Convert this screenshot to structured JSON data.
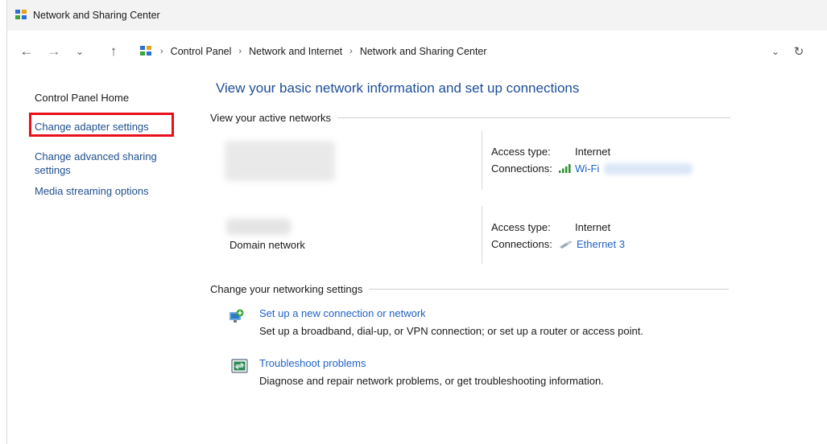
{
  "window": {
    "title": "Network and Sharing Center"
  },
  "nav": {
    "back_icon": "back-arrow-icon",
    "forward_icon": "forward-arrow-icon",
    "recent_icon": "chevron-down-icon",
    "up_icon": "up-arrow-icon",
    "breadcrumb": [
      "Control Panel",
      "Network and Internet",
      "Network and Sharing Center"
    ],
    "dropdown_icon": "chevron-down-icon",
    "refresh_icon": "refresh-icon"
  },
  "left_pane": {
    "home": "Control Panel Home",
    "links": [
      "Change adapter settings",
      "Change advanced sharing settings",
      "Media streaming options"
    ],
    "highlight_color": "#e8101a"
  },
  "main": {
    "heading": "View your basic network information and set up connections",
    "active_networks_label": "View your active networks",
    "networks": [
      {
        "name_redacted": true,
        "category": "",
        "access_type_label": "Access type:",
        "access_type": "Internet",
        "connections_label": "Connections:",
        "connection": "Wi-Fi",
        "connection_icon": "wifi-signal-icon"
      },
      {
        "name_redacted": true,
        "category": "Domain network",
        "access_type_label": "Access type:",
        "access_type": "Internet",
        "connections_label": "Connections:",
        "connection": "Ethernet 3",
        "connection_icon": "ethernet-cable-icon"
      }
    ],
    "change_settings_label": "Change your networking settings",
    "tasks": [
      {
        "title": "Set up a new connection or network",
        "description": "Set up a broadband, dial-up, or VPN connection; or set up a router or access point.",
        "icon": "new-connection-icon"
      },
      {
        "title": "Troubleshoot problems",
        "description": "Diagnose and repair network problems, or get troubleshooting information.",
        "icon": "troubleshoot-icon"
      }
    ]
  },
  "colors": {
    "link": "#1f62c5",
    "heading": "#1e4e99",
    "highlight": "#e8101a"
  }
}
